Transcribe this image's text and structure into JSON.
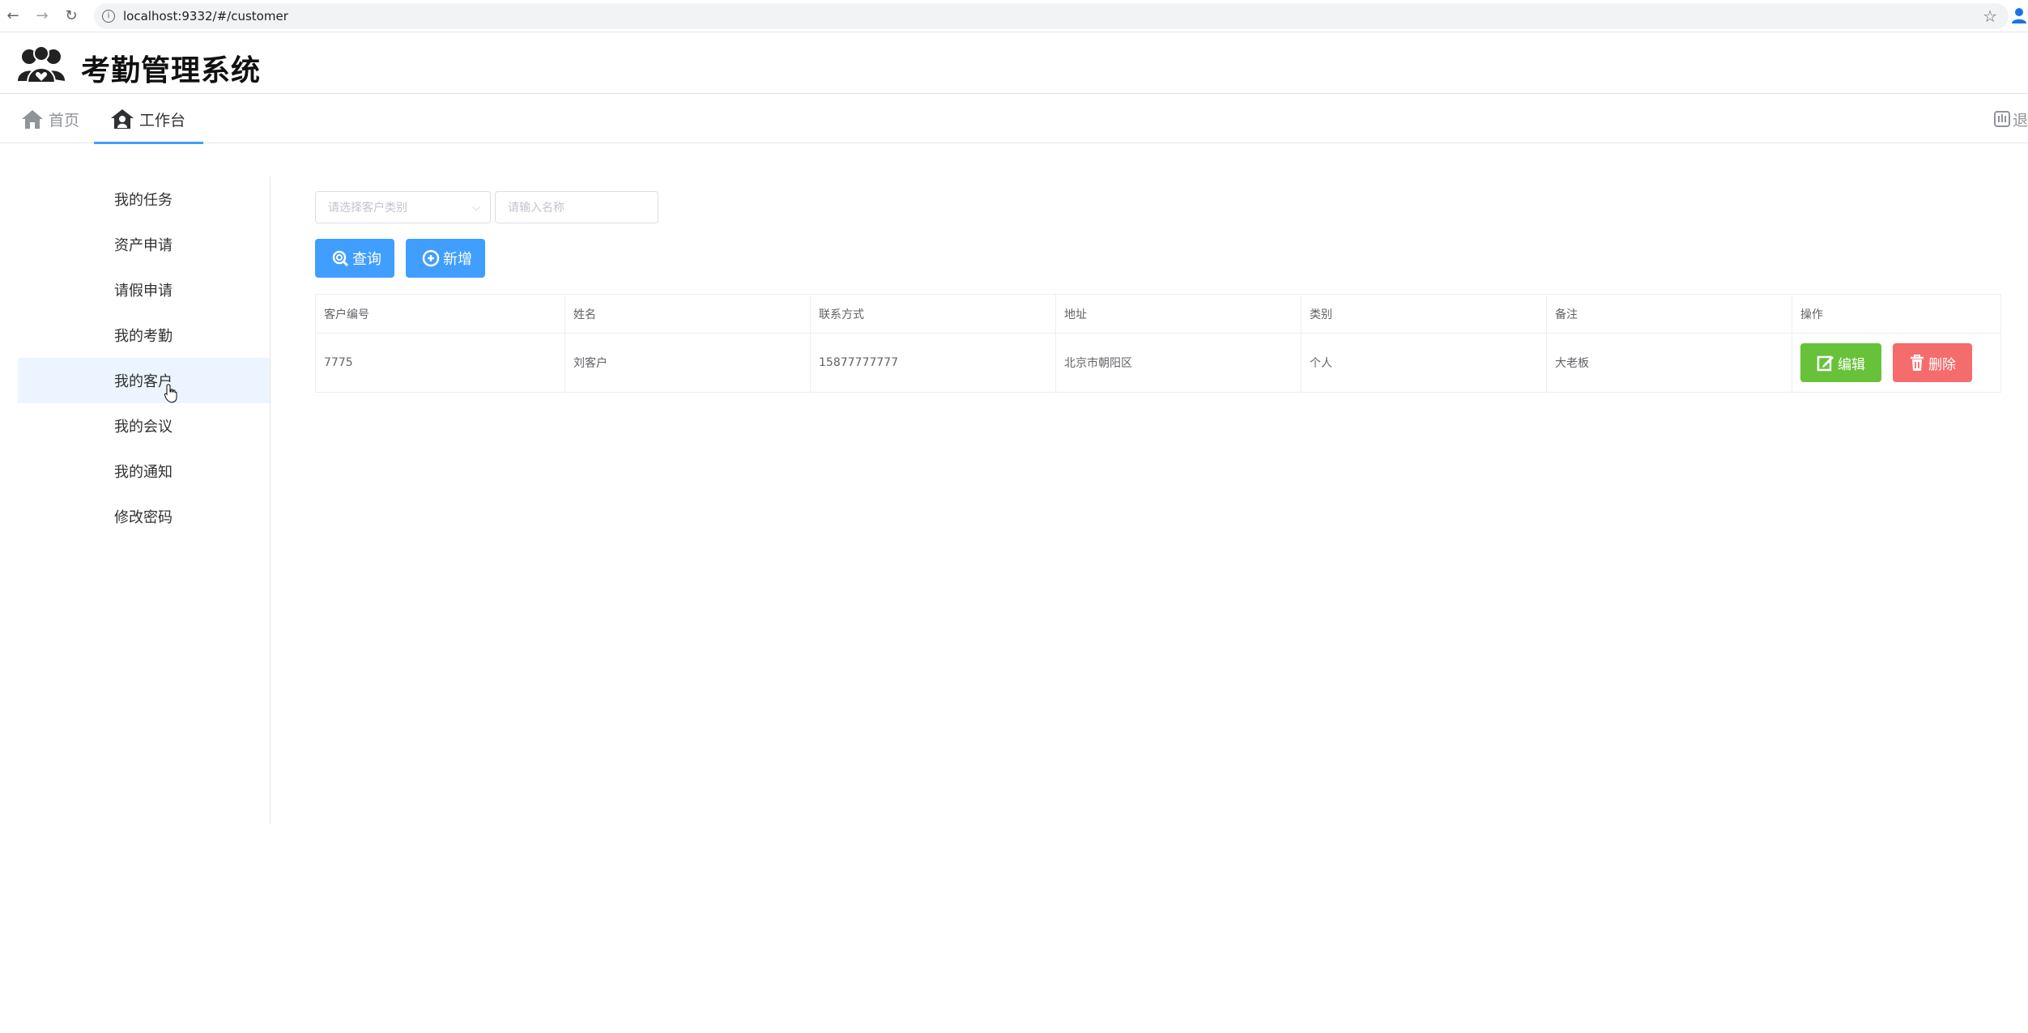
{
  "browser": {
    "url": "localhost:9332/#/customer"
  },
  "app": {
    "title": "考勤管理系统"
  },
  "topnav": {
    "home": "首页",
    "workbench": "工作台",
    "logout": "退"
  },
  "sidebar": {
    "items": [
      {
        "label": "我的任务"
      },
      {
        "label": "资产申请"
      },
      {
        "label": "请假申请"
      },
      {
        "label": "我的考勤"
      },
      {
        "label": "我的客户"
      },
      {
        "label": "我的会议"
      },
      {
        "label": "我的通知"
      },
      {
        "label": "修改密码"
      }
    ],
    "active_index": 4
  },
  "filters": {
    "category_placeholder": "请选择客户类别",
    "name_placeholder": "请输入名称"
  },
  "buttons": {
    "query": "查询",
    "add": "新增",
    "edit": "编辑",
    "delete": "删除"
  },
  "table": {
    "headers": [
      "客户编号",
      "姓名",
      "联系方式",
      "地址",
      "类别",
      "备注",
      "操作"
    ],
    "rows": [
      {
        "id": "7775",
        "name": "刘客户",
        "phone": "15877777777",
        "address": "北京市朝阳区",
        "category": "个人",
        "note": "大老板"
      }
    ]
  },
  "colors": {
    "primary": "#409eff",
    "success": "#67c23a",
    "danger": "#f56c6c",
    "active_bg": "#ecf5ff"
  }
}
